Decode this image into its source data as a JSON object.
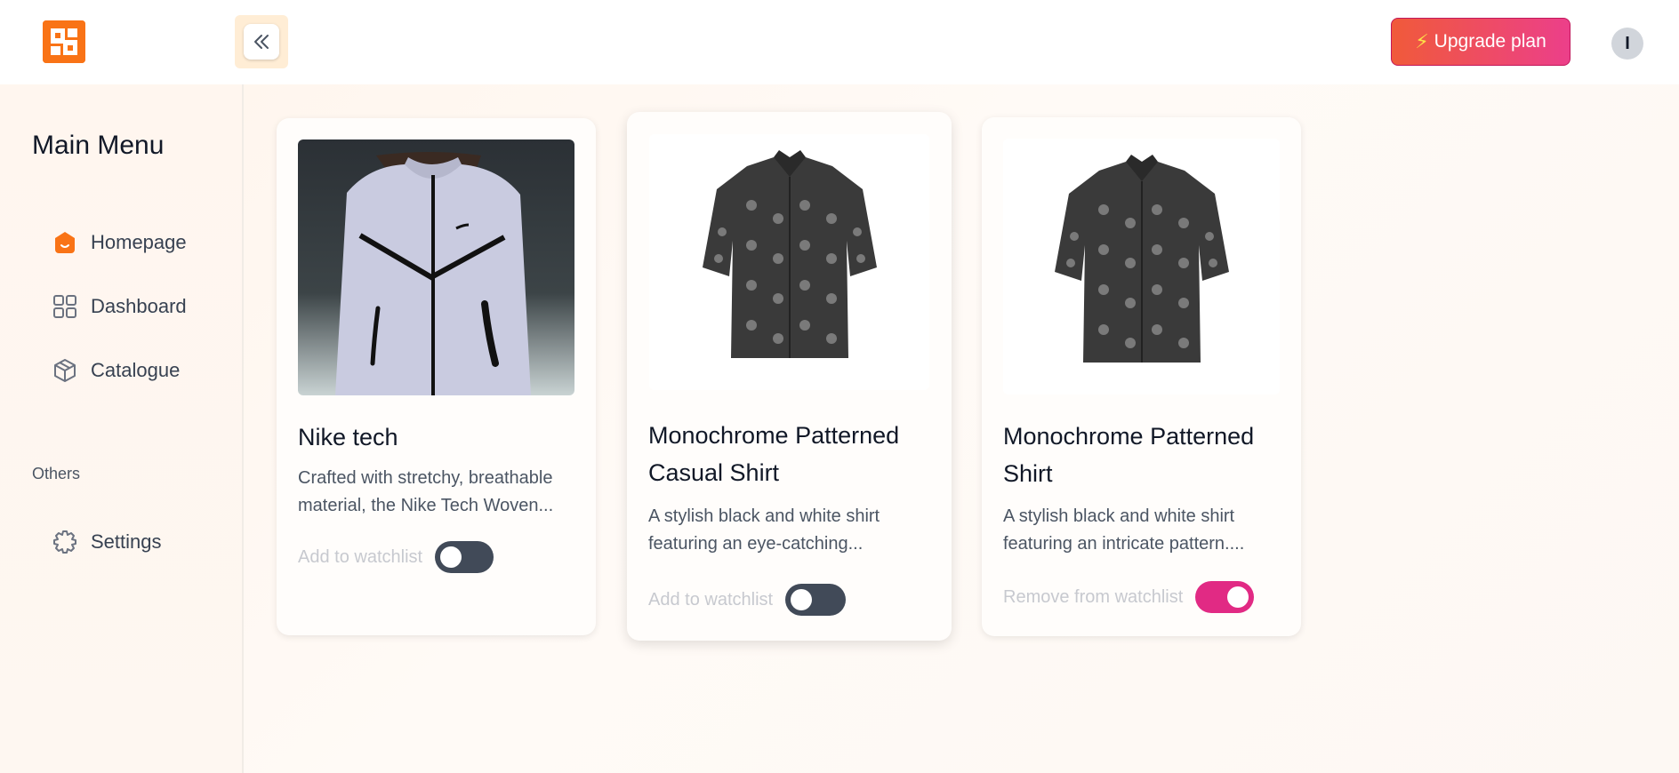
{
  "header": {
    "upgrade_label": "Upgrade plan",
    "avatar_initial": "I"
  },
  "sidebar": {
    "menu_title": "Main Menu",
    "items": [
      {
        "label": "Homepage",
        "icon": "home-icon"
      },
      {
        "label": "Dashboard",
        "icon": "grid-icon"
      },
      {
        "label": "Catalogue",
        "icon": "box-icon"
      }
    ],
    "section_label": "Others",
    "other_items": [
      {
        "label": "Settings",
        "icon": "gear-icon"
      }
    ]
  },
  "products": [
    {
      "title": "Nike tech",
      "description_lines": [
        "Crafted with stretchy, breathable",
        "material, the Nike Tech Woven..."
      ],
      "watch_label": "Add to watchlist",
      "watchlisted": false,
      "image": "jacket-photo"
    },
    {
      "title_lines": [
        "Monochrome Patterned",
        "Casual Shirt"
      ],
      "description_lines": [
        "A stylish black and white shirt",
        "featuring an eye-catching..."
      ],
      "watch_label": "Add to watchlist",
      "watchlisted": false,
      "image": "shirt-photo"
    },
    {
      "title_lines": [
        "Monochrome Patterned",
        "Shirt"
      ],
      "description_lines": [
        "A stylish black and white shirt",
        "featuring an intricate pattern...."
      ],
      "watch_label": "Remove from watchlist",
      "watchlisted": true,
      "image": "shirt-photo"
    }
  ],
  "colors": {
    "brand": "#f97316",
    "toggle_on": "#e12a84",
    "toggle_off": "#414a58"
  }
}
